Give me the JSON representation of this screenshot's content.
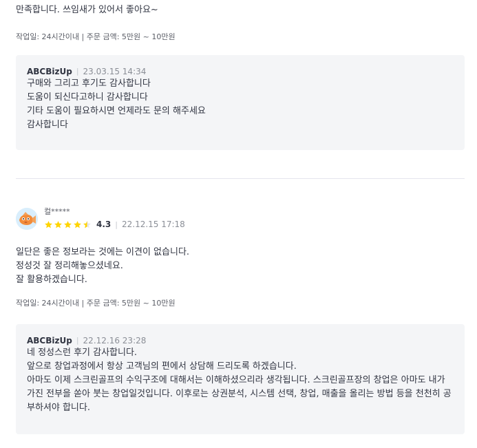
{
  "prev_review": {
    "body": "만족합니다. 쓰임새가 있어서 좋아요~",
    "meta": "작업일: 24시간이내 | 주문 금액: 5만원 ~ 10만원"
  },
  "prev_reply": {
    "author": "ABCBizUp",
    "date": "23.03.15 14:34",
    "lines": [
      "구매와 그리고 후기도 감사합니다",
      "도움이 되신다고하니 감사합니다",
      "기타 도움이 필요하시면 언제라도 문의 해주세요",
      "감사합니다"
    ]
  },
  "review": {
    "reviewer": "컬*****",
    "avatar_icon": "goldfish-avatar-icon",
    "rating": 4.3,
    "rating_label": "4.3",
    "stars_filled": 4,
    "stars_half": 1,
    "date": "22.12.15 17:18",
    "lines": [
      "일단은 좋은 정보라는 것에는 이견이 없습니다.",
      "정성것 잘 정리해놓으셨네요.",
      "잘 활용하겠습니다."
    ],
    "meta": "작업일: 24시간이내 | 주문 금액: 5만원 ~ 10만원"
  },
  "reply": {
    "author": "ABCBizUp",
    "date": "22.12.16 23:28",
    "lines": [
      "네 정성스런 후기 감사합니다.",
      "앞으로 창업과정에서 항상 고객님의 편에서 상담해 드리도록 하겠습니다.",
      "아마도 이제 스크린골프의 수익구조에 대해서는 이해하셨으리라 생각됩니다.  스크린골프장의 창업은 아마도 내가 가진 전부을 쏟아 붓는 창업일것입니다. 이후로는 상권분석, 시스템 선택, 창업, 매출을 올리는 방법 등을 천천히 공부하셔야 합니다."
    ]
  },
  "colors": {
    "star": "#ffd400",
    "reply_bg": "#f4f5f7",
    "divider": "#e4e5ed",
    "text": "#303441"
  }
}
